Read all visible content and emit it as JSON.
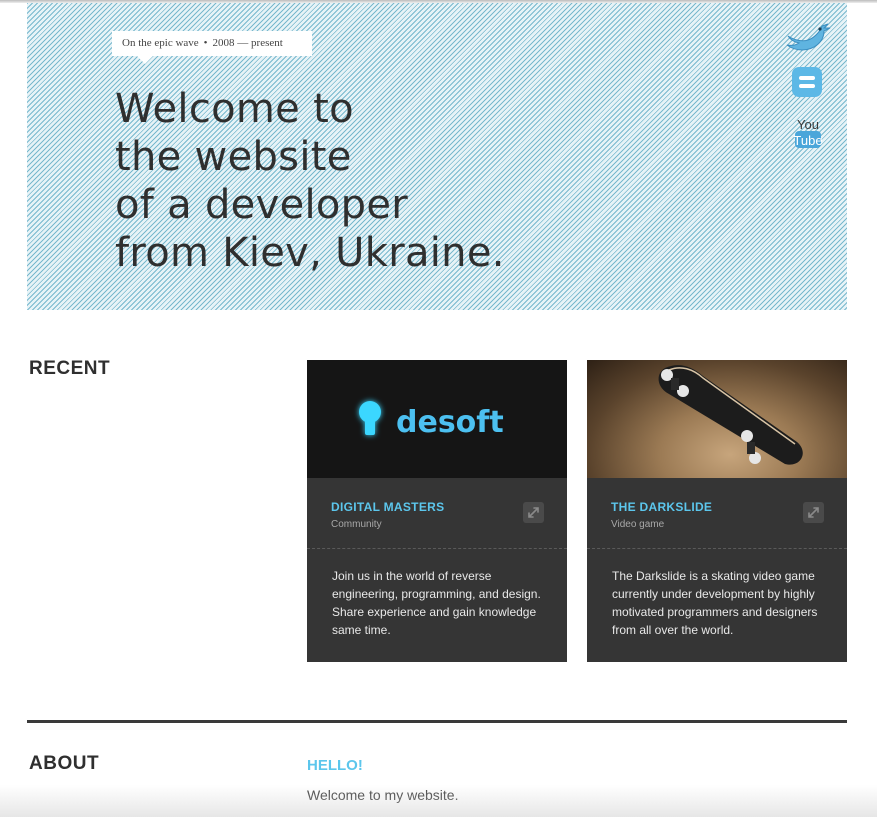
{
  "hero": {
    "tagline": {
      "prefix": "On the epic wave",
      "bullet": "•",
      "years": "2008 — present"
    },
    "title_lines": [
      "Welcome to",
      "the website",
      "of a developer",
      "from Kiev, Ukraine."
    ],
    "social": [
      {
        "name": "twitter",
        "icon": "twitter-bird-icon"
      },
      {
        "name": "blogger",
        "icon": "blogger-icon"
      },
      {
        "name": "youtube",
        "icon": "youtube-icon",
        "text_top": "You",
        "text_bottom": "Tube"
      }
    ]
  },
  "recent": {
    "title": "RECENT",
    "cards": [
      {
        "name": "DIGITAL MASTERS",
        "kind": "Community",
        "logo_text": "desoft",
        "description": "Join us in the world of reverse engineering, programming, and design. Share experience and gain knowledge same time."
      },
      {
        "name": "THE DARKSLIDE",
        "kind": "Video game",
        "description": "The Darkslide is a skating video game currently under development by highly motivated programmers and designers from all over the world."
      }
    ]
  },
  "about": {
    "title": "ABOUT",
    "heading": "HELLO!",
    "text": "Welcome to my website."
  },
  "colors": {
    "accent": "#5cc6ec",
    "card_bg": "#353535",
    "hero_stripe": "#78b8cd"
  }
}
